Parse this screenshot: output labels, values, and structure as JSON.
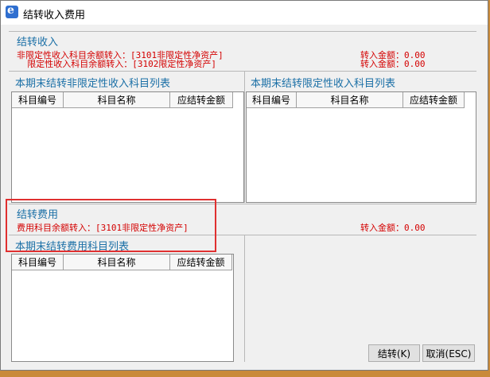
{
  "window": {
    "title": "结转收入费用"
  },
  "income": {
    "heading": "结转收入",
    "line1": "非限定性收入科目余额转入：[3101非限定性净资产]",
    "line2": "  限定性收入科目余额转入：[3102限定性净资产]",
    "amount1": "转入金额：0.00",
    "amount2": "转入金额：0.00",
    "left_list_title": "本期末结转非限定性收入科目列表",
    "right_list_title": "本期末结转限定性收入科目列表"
  },
  "expense": {
    "heading": "结转费用",
    "line1": "费用科目余额转入：[3101非限定性净资产]",
    "amount1": "转入金额：0.00",
    "list_title": "本期末结转费用科目列表"
  },
  "table_columns": [
    "科目编号",
    "科目名称",
    "应结转金额"
  ],
  "buttons": {
    "confirm": "结转(K)",
    "cancel": "取消(ESC)"
  }
}
